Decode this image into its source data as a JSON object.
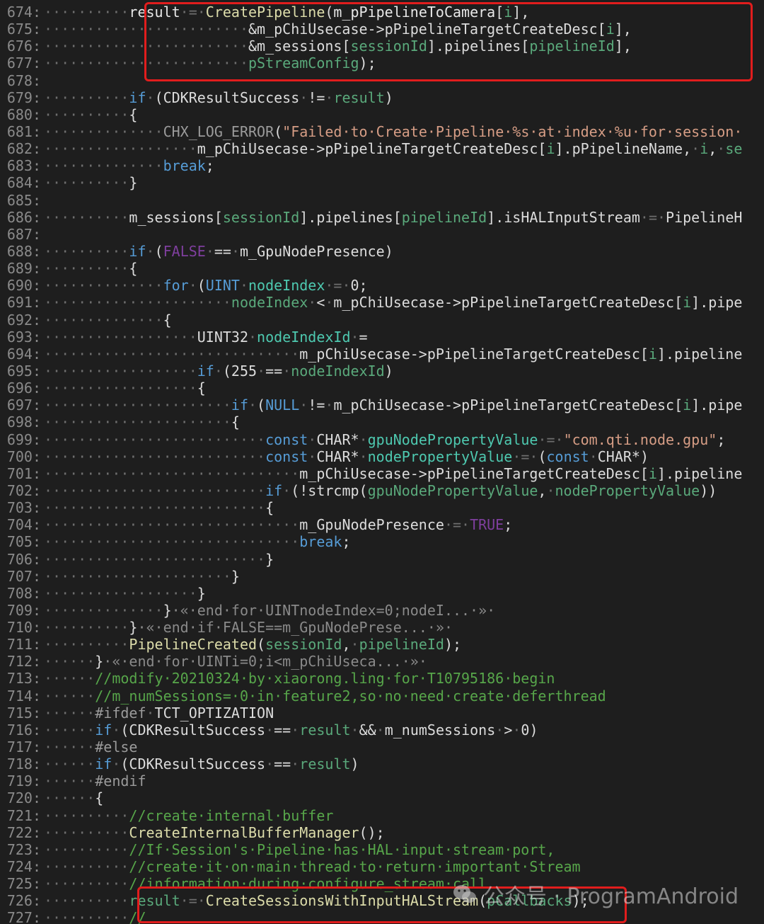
{
  "watermark": {
    "text": "公众号 · ProgramAndroid"
  },
  "lines": [
    {
      "n": "674:",
      "ind": "··········",
      "segs": [
        [
          "id",
          "result"
        ],
        [
          "ws",
          "·=·"
        ],
        [
          "fn",
          "CreatePipeline"
        ],
        [
          "pl",
          "("
        ],
        [
          "id",
          "m_pPipelineToCamera"
        ],
        [
          "pl",
          "["
        ],
        [
          "lvar",
          "i"
        ],
        [
          "pl",
          "],"
        ]
      ]
    },
    {
      "n": "675:",
      "ind": "························",
      "segs": [
        [
          "pl",
          "&m_pChiUsecase->pPipelineTargetCreateDesc["
        ],
        [
          "lvar",
          "i"
        ],
        [
          "pl",
          "],"
        ]
      ]
    },
    {
      "n": "676:",
      "ind": "························",
      "segs": [
        [
          "pl",
          "&m_sessions["
        ],
        [
          "lvar",
          "sessionId"
        ],
        [
          "pl",
          "].pipelines["
        ],
        [
          "lvar",
          "pipelineId"
        ],
        [
          "pl",
          "],"
        ]
      ]
    },
    {
      "n": "677:",
      "ind": "························",
      "segs": [
        [
          "lvar",
          "pStreamConfig"
        ],
        [
          "pl",
          ");"
        ]
      ]
    },
    {
      "n": "678:",
      "ind": "",
      "segs": []
    },
    {
      "n": "679:",
      "ind": "··········",
      "segs": [
        [
          "kw",
          "if"
        ],
        [
          "ws",
          "·"
        ],
        [
          "pl",
          "(CDKResultSuccess"
        ],
        [
          "ws",
          "·"
        ],
        [
          "pl",
          "!="
        ],
        [
          "ws",
          "·"
        ],
        [
          "lvar",
          "result"
        ],
        [
          "pl",
          ")"
        ]
      ]
    },
    {
      "n": "680:",
      "ind": "··········",
      "segs": [
        [
          "pl",
          "{"
        ]
      ]
    },
    {
      "n": "681:",
      "ind": "··············",
      "segs": [
        [
          "macro",
          "CHX_LOG_ERROR"
        ],
        [
          "pl",
          "("
        ],
        [
          "str",
          "\"Failed·to·Create·Pipeline·%s·at·index·%u·for·session·"
        ]
      ]
    },
    {
      "n": "682:",
      "ind": "··················",
      "segs": [
        [
          "pl",
          "m_pChiUsecase->pPipelineTargetCreateDesc["
        ],
        [
          "lvar",
          "i"
        ],
        [
          "pl",
          "].pPipelineName,"
        ],
        [
          "ws",
          "·"
        ],
        [
          "lvar",
          "i"
        ],
        [
          "pl",
          ","
        ],
        [
          "ws",
          "·"
        ],
        [
          "lvar",
          "se"
        ]
      ]
    },
    {
      "n": "683:",
      "ind": "··············",
      "segs": [
        [
          "kw",
          "break"
        ],
        [
          "pl",
          ";"
        ]
      ]
    },
    {
      "n": "684:",
      "ind": "··········",
      "segs": [
        [
          "pl",
          "}"
        ]
      ]
    },
    {
      "n": "685:",
      "ind": "",
      "segs": []
    },
    {
      "n": "686:",
      "ind": "··········",
      "segs": [
        [
          "pl",
          "m_sessions["
        ],
        [
          "lvar",
          "sessionId"
        ],
        [
          "pl",
          "].pipelines["
        ],
        [
          "lvar",
          "pipelineId"
        ],
        [
          "pl",
          "].isHALInputStream"
        ],
        [
          "ws",
          "·=·"
        ],
        [
          "pl",
          "PipelineH"
        ]
      ]
    },
    {
      "n": "687:",
      "ind": "",
      "segs": []
    },
    {
      "n": "688:",
      "ind": "··········",
      "segs": [
        [
          "kw",
          "if"
        ],
        [
          "ws",
          "·"
        ],
        [
          "pl",
          "("
        ],
        [
          "const",
          "FALSE"
        ],
        [
          "ws",
          "·"
        ],
        [
          "pl",
          "=="
        ],
        [
          "ws",
          "·"
        ],
        [
          "pl",
          "m_GpuNodePresence)"
        ]
      ]
    },
    {
      "n": "689:",
      "ind": "··········",
      "segs": [
        [
          "pl",
          "{"
        ]
      ]
    },
    {
      "n": "690:",
      "ind": "··············",
      "segs": [
        [
          "kw",
          "for"
        ],
        [
          "ws",
          "·"
        ],
        [
          "pl",
          "("
        ],
        [
          "kw",
          "UINT"
        ],
        [
          "ws",
          "·"
        ],
        [
          "var",
          "nodeIndex"
        ],
        [
          "ws",
          "·=·"
        ],
        [
          "pl",
          "0;"
        ]
      ]
    },
    {
      "n": "691:",
      "ind": "······················",
      "segs": [
        [
          "lvar",
          "nodeIndex"
        ],
        [
          "ws",
          "·"
        ],
        [
          "pl",
          "<"
        ],
        [
          "ws",
          "·"
        ],
        [
          "pl",
          "m_pChiUsecase->pPipelineTargetCreateDesc["
        ],
        [
          "lvar",
          "i"
        ],
        [
          "pl",
          "].pipe"
        ]
      ]
    },
    {
      "n": "692:",
      "ind": "··············",
      "segs": [
        [
          "pl",
          "{"
        ]
      ]
    },
    {
      "n": "693:",
      "ind": "··················",
      "segs": [
        [
          "pl",
          "UINT32"
        ],
        [
          "ws",
          "·"
        ],
        [
          "var",
          "nodeIndexId"
        ],
        [
          "ws",
          "·"
        ],
        [
          "pl",
          "="
        ]
      ]
    },
    {
      "n": "694:",
      "ind": "······························",
      "segs": [
        [
          "pl",
          "m_pChiUsecase->pPipelineTargetCreateDesc["
        ],
        [
          "lvar",
          "i"
        ],
        [
          "pl",
          "].pipeline"
        ]
      ]
    },
    {
      "n": "695:",
      "ind": "··················",
      "segs": [
        [
          "kw",
          "if"
        ],
        [
          "ws",
          "·"
        ],
        [
          "pl",
          "(255"
        ],
        [
          "ws",
          "·"
        ],
        [
          "pl",
          "=="
        ],
        [
          "ws",
          "·"
        ],
        [
          "lvar",
          "nodeIndexId"
        ],
        [
          "pl",
          ")"
        ]
      ]
    },
    {
      "n": "696:",
      "ind": "··················",
      "segs": [
        [
          "pl",
          "{"
        ]
      ]
    },
    {
      "n": "697:",
      "ind": "······················",
      "segs": [
        [
          "kw",
          "if"
        ],
        [
          "ws",
          "·"
        ],
        [
          "pl",
          "("
        ],
        [
          "kw",
          "NULL"
        ],
        [
          "ws",
          "·"
        ],
        [
          "pl",
          "!="
        ],
        [
          "ws",
          "·"
        ],
        [
          "pl",
          "m_pChiUsecase->pPipelineTargetCreateDesc["
        ],
        [
          "lvar",
          "i"
        ],
        [
          "pl",
          "].pipe"
        ]
      ]
    },
    {
      "n": "698:",
      "ind": "······················",
      "segs": [
        [
          "pl",
          "{"
        ]
      ]
    },
    {
      "n": "699:",
      "ind": "··························",
      "segs": [
        [
          "kw",
          "const"
        ],
        [
          "ws",
          "·"
        ],
        [
          "pl",
          "CHAR*"
        ],
        [
          "ws",
          "·"
        ],
        [
          "var",
          "gpuNodePropertyValue"
        ],
        [
          "ws",
          "·=·"
        ],
        [
          "str",
          "\"com.qti.node.gpu\""
        ],
        [
          "pl",
          ";"
        ]
      ]
    },
    {
      "n": "700:",
      "ind": "··························",
      "segs": [
        [
          "kw",
          "const"
        ],
        [
          "ws",
          "·"
        ],
        [
          "pl",
          "CHAR*"
        ],
        [
          "ws",
          "·"
        ],
        [
          "var",
          "nodePropertyValue"
        ],
        [
          "ws",
          "·=·"
        ],
        [
          "pl",
          "("
        ],
        [
          "kw",
          "const"
        ],
        [
          "ws",
          "·"
        ],
        [
          "pl",
          "CHAR*)"
        ]
      ]
    },
    {
      "n": "701:",
      "ind": "······························",
      "segs": [
        [
          "pl",
          "m_pChiUsecase->pPipelineTargetCreateDesc["
        ],
        [
          "lvar",
          "i"
        ],
        [
          "pl",
          "].pipeline"
        ]
      ]
    },
    {
      "n": "702:",
      "ind": "··························",
      "segs": [
        [
          "kw",
          "if"
        ],
        [
          "ws",
          "·"
        ],
        [
          "pl",
          "(!strcmp("
        ],
        [
          "lvar",
          "gpuNodePropertyValue"
        ],
        [
          "pl",
          ","
        ],
        [
          "ws",
          "·"
        ],
        [
          "lvar",
          "nodePropertyValue"
        ],
        [
          "pl",
          "))"
        ]
      ]
    },
    {
      "n": "703:",
      "ind": "··························",
      "segs": [
        [
          "pl",
          "{"
        ]
      ]
    },
    {
      "n": "704:",
      "ind": "······························",
      "segs": [
        [
          "pl",
          "m_GpuNodePresence"
        ],
        [
          "ws",
          "·=·"
        ],
        [
          "const",
          "TRUE"
        ],
        [
          "pl",
          ";"
        ]
      ]
    },
    {
      "n": "705:",
      "ind": "······························",
      "segs": [
        [
          "kw",
          "break"
        ],
        [
          "pl",
          ";"
        ]
      ]
    },
    {
      "n": "706:",
      "ind": "··························",
      "segs": [
        [
          "pl",
          "}"
        ]
      ]
    },
    {
      "n": "707:",
      "ind": "······················",
      "segs": [
        [
          "pl",
          "}"
        ]
      ]
    },
    {
      "n": "708:",
      "ind": "··················",
      "segs": [
        [
          "pl",
          "}"
        ]
      ]
    },
    {
      "n": "709:",
      "ind": "··············",
      "segs": [
        [
          "pl",
          "}"
        ],
        [
          "dim",
          "·«·end·for·UINTnodeIndex=0;nodeI...·»·"
        ]
      ]
    },
    {
      "n": "710:",
      "ind": "··········",
      "segs": [
        [
          "pl",
          "}"
        ],
        [
          "dim",
          "·«·end·if·FALSE==m_GpuNodePrese...·»·"
        ]
      ]
    },
    {
      "n": "711:",
      "ind": "··········",
      "segs": [
        [
          "fn",
          "PipelineCreated"
        ],
        [
          "pl",
          "("
        ],
        [
          "lvar",
          "sessionId"
        ],
        [
          "pl",
          ","
        ],
        [
          "ws",
          "·"
        ],
        [
          "lvar",
          "pipelineId"
        ],
        [
          "pl",
          ");"
        ]
      ]
    },
    {
      "n": "712:",
      "ind": "······",
      "segs": [
        [
          "pl",
          "}"
        ],
        [
          "dim",
          "·«·end·for·UINTi=0;i<m_pChiUseca...·»·"
        ]
      ]
    },
    {
      "n": "713:",
      "ind": "······",
      "segs": [
        [
          "cmt",
          "//modify·20210324·by·xiaorong.ling·for·T10795186·begin"
        ]
      ]
    },
    {
      "n": "714:",
      "ind": "······",
      "segs": [
        [
          "cmt",
          "//m_numSessions=·0·in·feature2,so·no·need·create·deferthread"
        ]
      ]
    },
    {
      "n": "715:",
      "ind": "······",
      "segs": [
        [
          "pre",
          "#ifdef"
        ],
        [
          "ws",
          "·"
        ],
        [
          "pl",
          "TCT_OPTIZATION"
        ]
      ]
    },
    {
      "n": "716:",
      "ind": "······",
      "segs": [
        [
          "kw",
          "if"
        ],
        [
          "ws",
          "·"
        ],
        [
          "pl",
          "(CDKResultSuccess"
        ],
        [
          "ws",
          "·"
        ],
        [
          "pl",
          "=="
        ],
        [
          "ws",
          "·"
        ],
        [
          "lvar",
          "result"
        ],
        [
          "ws",
          "·"
        ],
        [
          "pl",
          "&&"
        ],
        [
          "ws",
          "·"
        ],
        [
          "pl",
          "m_numSessions"
        ],
        [
          "ws",
          "·"
        ],
        [
          "pl",
          ">"
        ],
        [
          "ws",
          "·"
        ],
        [
          "pl",
          "0)"
        ]
      ]
    },
    {
      "n": "717:",
      "ind": "······",
      "segs": [
        [
          "pre",
          "#else"
        ]
      ]
    },
    {
      "n": "718:",
      "ind": "······",
      "segs": [
        [
          "kw",
          "if"
        ],
        [
          "ws",
          "·"
        ],
        [
          "pl",
          "(CDKResultSuccess"
        ],
        [
          "ws",
          "·"
        ],
        [
          "pl",
          "=="
        ],
        [
          "ws",
          "·"
        ],
        [
          "lvar",
          "result"
        ],
        [
          "pl",
          ")"
        ]
      ]
    },
    {
      "n": "719:",
      "ind": "······",
      "segs": [
        [
          "pre",
          "#endif"
        ]
      ]
    },
    {
      "n": "720:",
      "ind": "······",
      "segs": [
        [
          "pl",
          "{"
        ]
      ]
    },
    {
      "n": "721:",
      "ind": "··········",
      "segs": [
        [
          "cmt",
          "//create·internal·buffer"
        ]
      ]
    },
    {
      "n": "722:",
      "ind": "··········",
      "segs": [
        [
          "fn",
          "CreateInternalBufferManager"
        ],
        [
          "pl",
          "();"
        ]
      ]
    },
    {
      "n": "723:",
      "ind": "··········",
      "segs": [
        [
          "cmt",
          "//If·Session's·Pipeline·has·HAL·input·stream·port,"
        ]
      ]
    },
    {
      "n": "724:",
      "ind": "··········",
      "segs": [
        [
          "cmt",
          "//create·it·on·main·thread·to·return·important·Stream"
        ]
      ]
    },
    {
      "n": "725:",
      "ind": "··········",
      "segs": [
        [
          "cmt",
          "//information·during·configure_stream·call."
        ]
      ]
    },
    {
      "n": "726:",
      "ind": "··········",
      "segs": [
        [
          "lvar",
          "result"
        ],
        [
          "ws",
          "·=·"
        ],
        [
          "fn",
          "CreateSessionsWithInputHALStream"
        ],
        [
          "pl",
          "("
        ],
        [
          "lvar",
          "pCallbacks"
        ],
        [
          "pl",
          ");"
        ]
      ]
    },
    {
      "n": "727:",
      "ind": "··········",
      "segs": [
        [
          "cmt",
          "//"
        ]
      ]
    }
  ]
}
